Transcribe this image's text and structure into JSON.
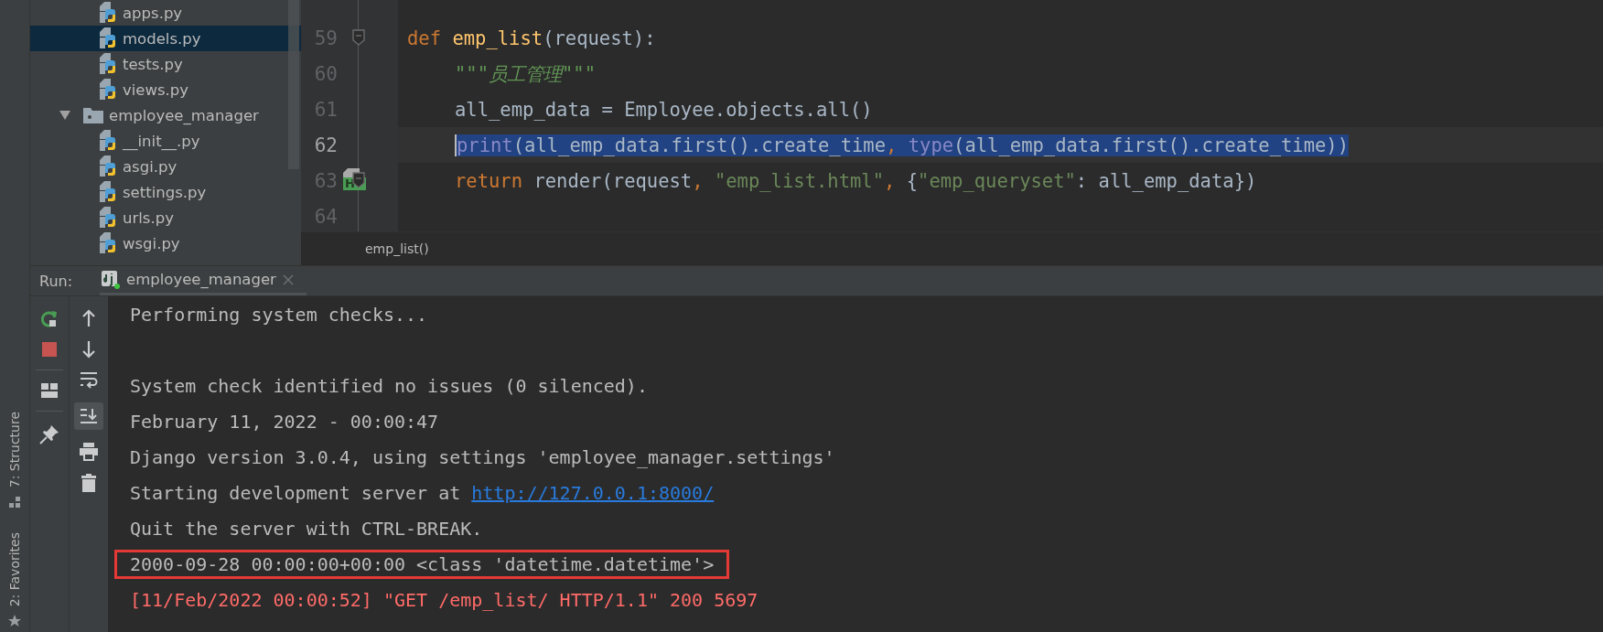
{
  "project_tree": {
    "items": [
      {
        "name": "apps.py",
        "kind": "file",
        "selected": false
      },
      {
        "name": "models.py",
        "kind": "file",
        "selected": true
      },
      {
        "name": "tests.py",
        "kind": "file",
        "selected": false
      },
      {
        "name": "views.py",
        "kind": "file",
        "selected": false
      },
      {
        "name": "employee_manager",
        "kind": "folder",
        "selected": false,
        "expanded": true,
        "children": [
          {
            "name": "__init__.py",
            "kind": "file",
            "selected": false
          },
          {
            "name": "asgi.py",
            "kind": "file",
            "selected": false
          },
          {
            "name": "settings.py",
            "kind": "file",
            "selected": false
          },
          {
            "name": "urls.py",
            "kind": "file",
            "selected": false
          },
          {
            "name": "wsgi.py",
            "kind": "file",
            "selected": false
          }
        ]
      }
    ]
  },
  "editor": {
    "lines": [
      {
        "number": "59",
        "current": false,
        "selected": false,
        "fold": true,
        "indented": false,
        "tokens": [
          {
            "kind": "keyword",
            "text": "def "
          },
          {
            "kind": "function",
            "text": "emp_list"
          },
          {
            "kind": "plain",
            "text": "(request):"
          }
        ]
      },
      {
        "number": "60",
        "current": false,
        "selected": false,
        "fold": false,
        "indented": true,
        "tokens": [
          {
            "kind": "docstring",
            "text": "\"\"\"员工管理\"\"\""
          }
        ]
      },
      {
        "number": "61",
        "current": false,
        "selected": false,
        "fold": false,
        "indented": true,
        "tokens": [
          {
            "kind": "plain",
            "text": "all_emp_data = Employee.objects.all()"
          }
        ]
      },
      {
        "number": "62",
        "current": true,
        "selected": true,
        "fold": false,
        "indented": true,
        "tokens": [
          {
            "kind": "builtin",
            "text": "print"
          },
          {
            "kind": "plain",
            "text": "(all_emp_data.first().create_time"
          },
          {
            "kind": "keyword",
            "text": ", "
          },
          {
            "kind": "builtin",
            "text": "type"
          },
          {
            "kind": "plain",
            "text": "(all_emp_data.first().create_time))"
          }
        ]
      },
      {
        "number": "63",
        "current": false,
        "selected": false,
        "fold": true,
        "indented": true,
        "badge": "H",
        "tokens": [
          {
            "kind": "keyword",
            "text": "return "
          },
          {
            "kind": "plain",
            "text": "render(request"
          },
          {
            "kind": "keyword",
            "text": ", "
          },
          {
            "kind": "string",
            "text": "\"emp_list.html\""
          },
          {
            "kind": "keyword",
            "text": ", "
          },
          {
            "kind": "plain",
            "text": "{"
          },
          {
            "kind": "string",
            "text": "\"emp_queryset\""
          },
          {
            "kind": "plain",
            "text": ": all_emp_data})"
          }
        ]
      },
      {
        "number": "64",
        "current": false,
        "fold": false
      }
    ],
    "breadcrumb": "emp_list()"
  },
  "run_panel": {
    "label": "Run:",
    "tab": {
      "title": "employee_manager",
      "selected": true
    },
    "console": [
      {
        "kind": "plain",
        "text": "Performing system checks..."
      },
      {
        "kind": "blank"
      },
      {
        "kind": "plain",
        "text": "System check identified no issues (0 silenced)."
      },
      {
        "kind": "plain",
        "text": "February 11, 2022 - 00:00:47"
      },
      {
        "kind": "plain",
        "text": "Django version 3.0.4, using settings 'employee_manager.settings'"
      },
      {
        "kind": "link",
        "text": "Starting development server at ",
        "link": "http://127.0.0.1:8000/"
      },
      {
        "kind": "plain",
        "text": "Quit the server with CTRL-BREAK."
      },
      {
        "kind": "boxed",
        "text": "2000-09-28 00:00:00+00:00 <class 'datetime.datetime'>"
      },
      {
        "kind": "error",
        "text": "[11/Feb/2022 00:00:52] \"GET /emp_list/ HTTP/1.1\" 200 5697"
      }
    ]
  },
  "side_tool_windows": [
    {
      "kind": "structure",
      "label": "7: Structure"
    },
    {
      "kind": "favorites",
      "label": "2: Favorites"
    }
  ]
}
